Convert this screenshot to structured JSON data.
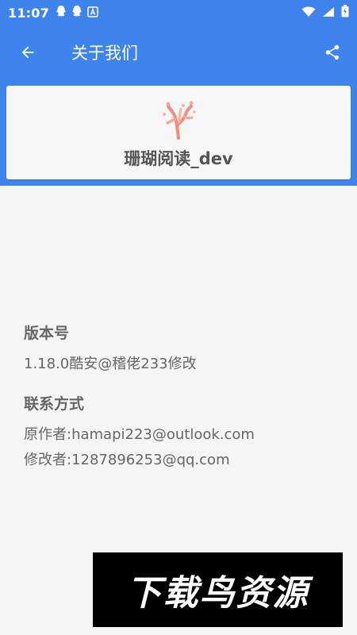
{
  "status_bar": {
    "time": "11:07",
    "icons": [
      "qq-icon",
      "qq-icon",
      "font-icon",
      "wifi-icon",
      "signal-icon",
      "battery-icon"
    ]
  },
  "app_bar": {
    "title": "关于我们",
    "accent_color": "#3f84ec"
  },
  "app_card": {
    "name": "珊瑚阅读_dev"
  },
  "about": {
    "version_title": "版本号",
    "version_value": "1.18.0酷安@稽佬233修改",
    "contact_title": "联系方式",
    "original_author": "原作者:hamapi223@outlook.com",
    "modifier": "修改者:1287896253@qq.com"
  },
  "watermark": {
    "text": "下载鸟资源"
  }
}
